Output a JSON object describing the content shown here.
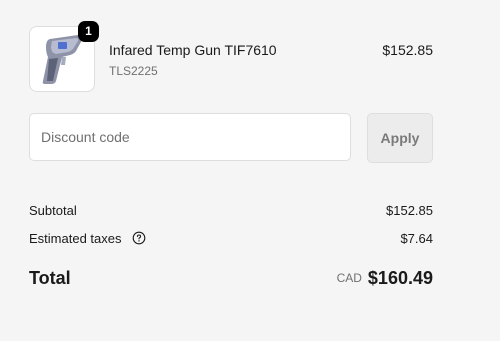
{
  "line_item": {
    "quantity": "1",
    "title": "Infared Temp Gun TIF7610",
    "sku": "TLS2225",
    "price": "$152.85",
    "image_icon": "temperature-gun-icon"
  },
  "discount": {
    "placeholder": "Discount code",
    "value": "",
    "apply_label": "Apply"
  },
  "summary": {
    "subtotal_label": "Subtotal",
    "subtotal_value": "$152.85",
    "taxes_label": "Estimated taxes",
    "taxes_value": "$7.64",
    "total_label": "Total",
    "currency": "CAD",
    "total_value": "$160.49"
  },
  "colors": {
    "background": "#f5f5f5",
    "badge": "#000000",
    "border": "#dedede",
    "muted_text": "#707070"
  }
}
